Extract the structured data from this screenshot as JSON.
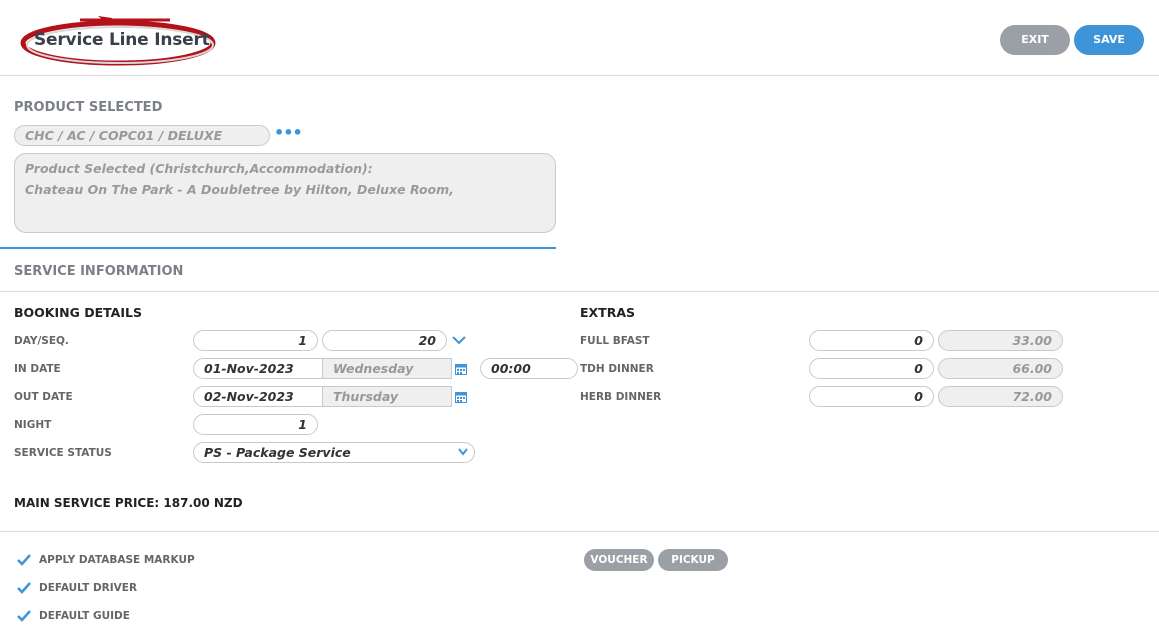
{
  "header": {
    "title": "Service Line Insert",
    "exit_label": "EXIT",
    "save_label": "SAVE"
  },
  "product": {
    "section_title": "PRODUCT SELECTED",
    "code": "CHC / AC / COPC01 / DELUXE",
    "description_line1": "Product Selected (Christchurch,Accommodation):",
    "description_line2": "Chateau On The Park - A Doubletree by Hilton, Deluxe Room,"
  },
  "service_info": {
    "section_title": "SERVICE INFORMATION"
  },
  "booking": {
    "title": "BOOKING DETAILS",
    "day_seq_label": "DAY/SEQ.",
    "day_value": "1",
    "seq_value": "20",
    "in_date_label": "IN DATE",
    "in_date": "01-Nov-2023",
    "in_day": "Wednesday",
    "in_time": "00:00",
    "out_date_label": "OUT DATE",
    "out_date": "02-Nov-2023",
    "out_day": "Thursday",
    "night_label": "NIGHT",
    "night_value": "1",
    "service_status_label": "SERVICE STATUS",
    "service_status_value": "PS - Package Service"
  },
  "extras": {
    "title": "EXTRAS",
    "items": [
      {
        "label": "FULL BFAST",
        "qty": "0",
        "price": "33.00"
      },
      {
        "label": "TDH DINNER",
        "qty": "0",
        "price": "66.00"
      },
      {
        "label": "HERB DINNER",
        "qty": "0",
        "price": "72.00"
      }
    ]
  },
  "main_price": "MAIN SERVICE PRICE: 187.00 NZD",
  "options": {
    "apply_markup": "APPLY DATABASE MARKUP",
    "default_driver": "DEFAULT DRIVER",
    "default_guide": "DEFAULT GUIDE"
  },
  "actions": {
    "voucher": "VOUCHER",
    "pickup": "PICKUP"
  },
  "colors": {
    "accent": "#3d94d8",
    "button_grey": "#9aa0a6",
    "logo_red": "#b3121b"
  },
  "icons": {
    "calendar": "calendar-icon",
    "check": "checkmark-icon",
    "chevron": "chevron-down-icon",
    "ellipsis": "ellipsis-icon"
  }
}
